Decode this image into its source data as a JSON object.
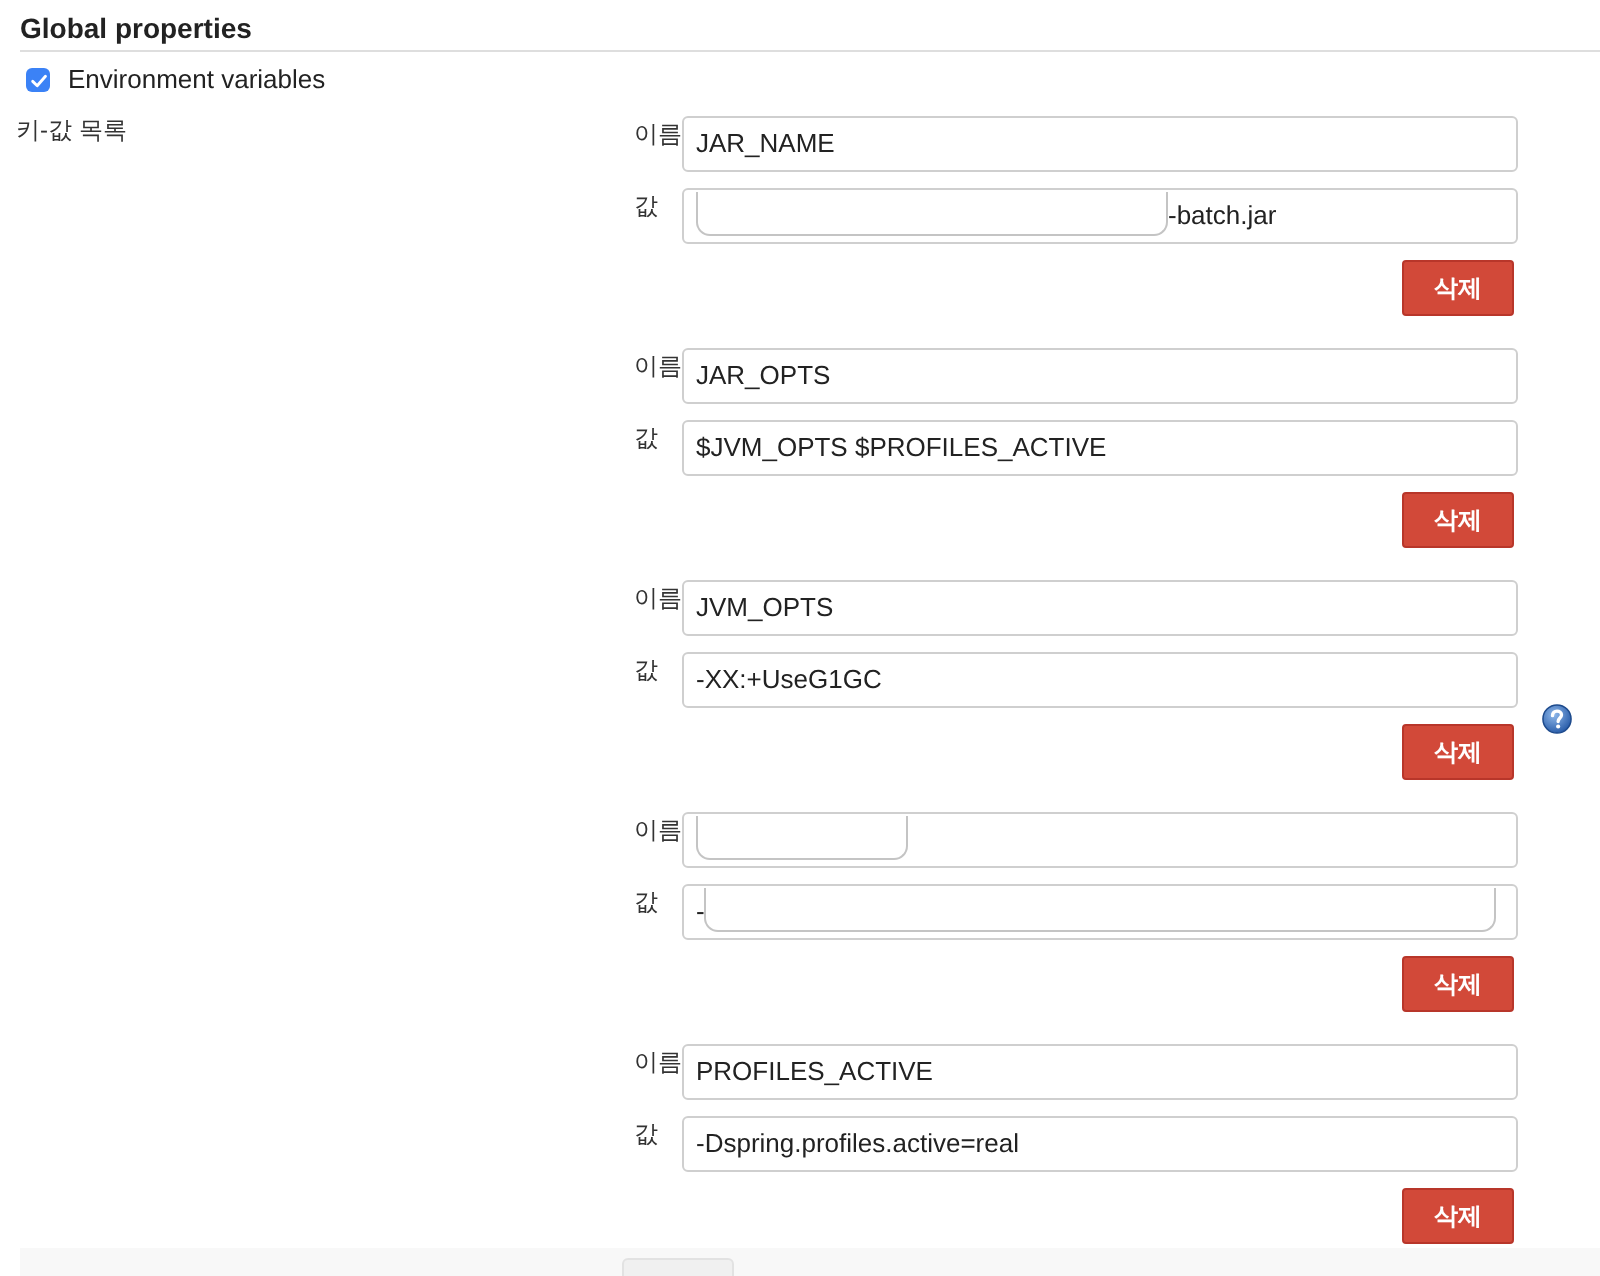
{
  "section": {
    "title": "Global properties"
  },
  "env_vars": {
    "label": "Environment variables",
    "checked": true
  },
  "list_label": "키-값 목록",
  "entries": [
    {
      "name_label": "이름",
      "name": {
        "value": "JAR_NAME"
      },
      "value_label": "값",
      "value": {
        "masked": true,
        "suffix": "-batch.jar"
      },
      "delete_button": "삭제"
    },
    {
      "name_label": "이름",
      "name": {
        "value": "JAR_OPTS"
      },
      "value_label": "값",
      "value": {
        "value": "$JVM_OPTS $PROFILES_ACTIVE"
      },
      "delete_button": "삭제"
    },
    {
      "name_label": "이름",
      "name": {
        "value": "JVM_OPTS"
      },
      "value_label": "값",
      "value": {
        "value": "-XX:+UseG1GC"
      },
      "delete_button": "삭제",
      "help": true
    },
    {
      "name_label": "이름",
      "name": {
        "masked": true
      },
      "value_label": "값",
      "value": {
        "value": "-",
        "masked": true
      },
      "delete_button": "삭제"
    },
    {
      "name_label": "이름",
      "name": {
        "value": "PROFILES_ACTIVE"
      },
      "value_label": "값",
      "value": {
        "value": "-Dspring.profiles.active=real"
      },
      "delete_button": "삭제"
    }
  ]
}
